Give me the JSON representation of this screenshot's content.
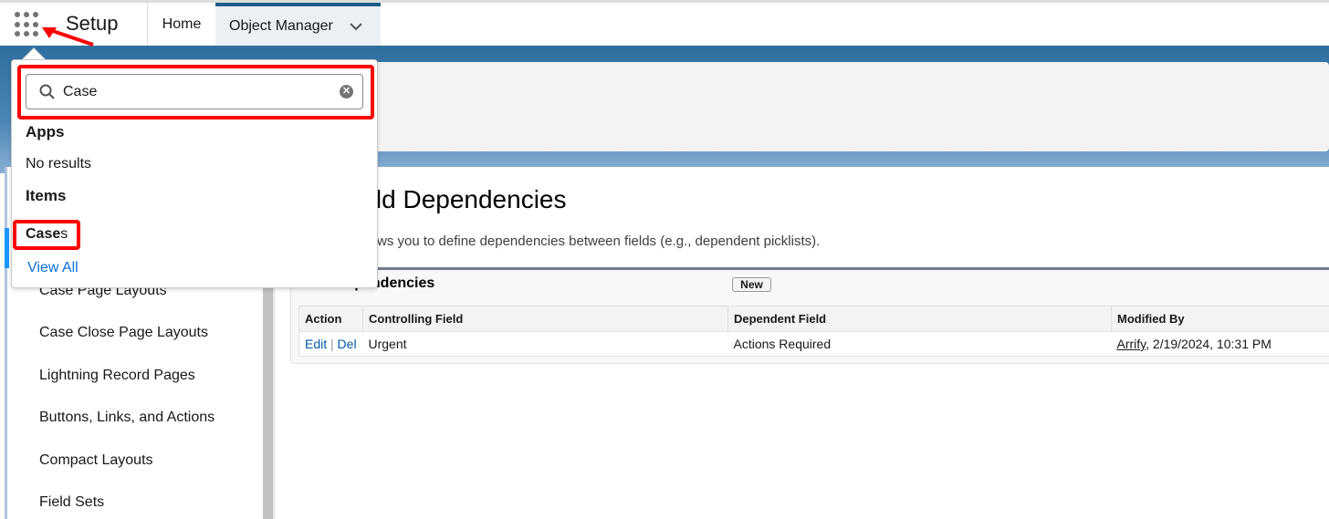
{
  "header": {
    "app_name": "Setup",
    "tabs": [
      {
        "label": "Home"
      },
      {
        "label": "Object Manager"
      }
    ]
  },
  "sidebar": {
    "items": [
      {
        "label": "Case Page Layouts"
      },
      {
        "label": "Case Close Page Layouts"
      },
      {
        "label": "Lightning Record Pages"
      },
      {
        "label": "Buttons, Links, and Actions"
      },
      {
        "label": "Compact Layouts"
      },
      {
        "label": "Field Sets"
      }
    ]
  },
  "main": {
    "title": "Field Dependencies",
    "description": "ws you to define dependencies between fields (e.g., dependent picklists).",
    "section_title": "Field Dependencies",
    "new_label": "New",
    "table": {
      "columns": [
        "Action",
        "Controlling Field",
        "Dependent Field",
        "Modified By"
      ],
      "rows": [
        {
          "edit": "Edit",
          "sep": "|",
          "del": "Del",
          "controlling": "Urgent",
          "dependent": "Actions Required",
          "modified_user": "Arrify",
          "modified_rest": ", 2/19/2024, 10:31 PM"
        }
      ]
    }
  },
  "app_launcher": {
    "search_value": "Case",
    "apps_heading": "Apps",
    "apps_empty": "No results",
    "items_heading": "Items",
    "items": [
      {
        "label_match": "Case",
        "label_rest": "s"
      }
    ],
    "view_all": "View All"
  },
  "annotation_color": "#ff0000"
}
